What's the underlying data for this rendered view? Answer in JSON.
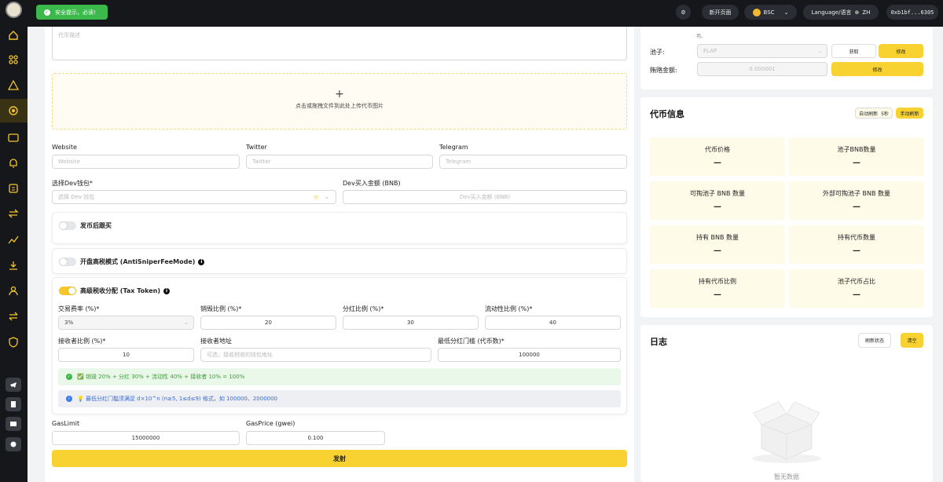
{
  "toast": {
    "text": "安全提示，必读!"
  },
  "topbar": {
    "new_page": "新开页面",
    "network": "BSC",
    "language_label": "Language/语言",
    "language": "ZH",
    "wallet": "0xb1bf...6305"
  },
  "form": {
    "desc_placeholder": "代币描述",
    "upload_text": "点击或拖拽文件到此处上传代币图片",
    "website_label": "Website",
    "website_placeholder": "Website",
    "twitter_label": "Twitter",
    "twitter_placeholder": "Twitter",
    "telegram_label": "Telegram",
    "telegram_placeholder": "Telegram",
    "dev_wallet_label": "选择Dev钱包*",
    "dev_wallet_placeholder": "选择 Dev 钱包",
    "dev_buy_label": "Dev买入金额 (BNB)",
    "dev_buy_placeholder": "Dev买入金额 (BNB)",
    "follow_buy_label": "发币后跟买",
    "anti_sniper_label": "开盘高税模式 (AntiSniperFeeMode)",
    "tax_label": "高级税收分配 (Tax Token)",
    "fee_rate_label": "交易费率 (%)*",
    "fee_rate_value": "3%",
    "burn_label": "销毁比例 (%)*",
    "burn_value": "20",
    "dividend_label": "分红比例 (%)*",
    "dividend_value": "30",
    "liquidity_label": "流动性比例 (%)*",
    "liquidity_value": "40",
    "receiver_ratio_label": "接收者比例 (%)*",
    "receiver_ratio_value": "10",
    "receiver_addr_label": "接收者地址",
    "receiver_addr_placeholder": "可选，接收税收的钱包地址",
    "min_threshold_label": "最低分红门槛 (代币数)*",
    "min_threshold_value": "100000",
    "success_msg": "✅ 销毁 20% + 分红 30% + 流动性 40% + 接收者 10% = 100%",
    "hint_msg": "💡 最低分红门槛须满足 d×10^n (n≥5, 1≤d≤9) 格式，如 100000、2000000",
    "gaslimit_label": "GasLimit",
    "gaslimit_value": "15000000",
    "gasprice_label": "GasPrice (gwei)",
    "gasprice_value": "0.100",
    "submit": "发射"
  },
  "pool": {
    "note": "用。",
    "pool_label": "池子:",
    "pool_value": "FLAP",
    "fetch": "获取",
    "modify": "修改",
    "bribe_label": "贿赂金额:",
    "bribe_value": "0.000001",
    "modify2": "修改"
  },
  "tokeninfo": {
    "title": "代币信息",
    "auto_refresh": "自动刷新",
    "interval": "5秒",
    "manual_refresh": "手动刷新",
    "stats": [
      {
        "label": "代币价格",
        "value": "—"
      },
      {
        "label": "池子BNB数量",
        "value": "—"
      },
      {
        "label": "可掏池子 BNB 数量",
        "value": "—"
      },
      {
        "label": "外部可掏池子 BNB 数量",
        "value": "—"
      },
      {
        "label": "持有 BNB 数量",
        "value": "—"
      },
      {
        "label": "持有代币数量",
        "value": "—"
      },
      {
        "label": "持有代币比例",
        "value": "—"
      },
      {
        "label": "池子代币占比",
        "value": "—"
      }
    ]
  },
  "log": {
    "title": "日志",
    "refresh_status": "刷新状态",
    "clear": "清空",
    "empty": "暂无数据"
  }
}
